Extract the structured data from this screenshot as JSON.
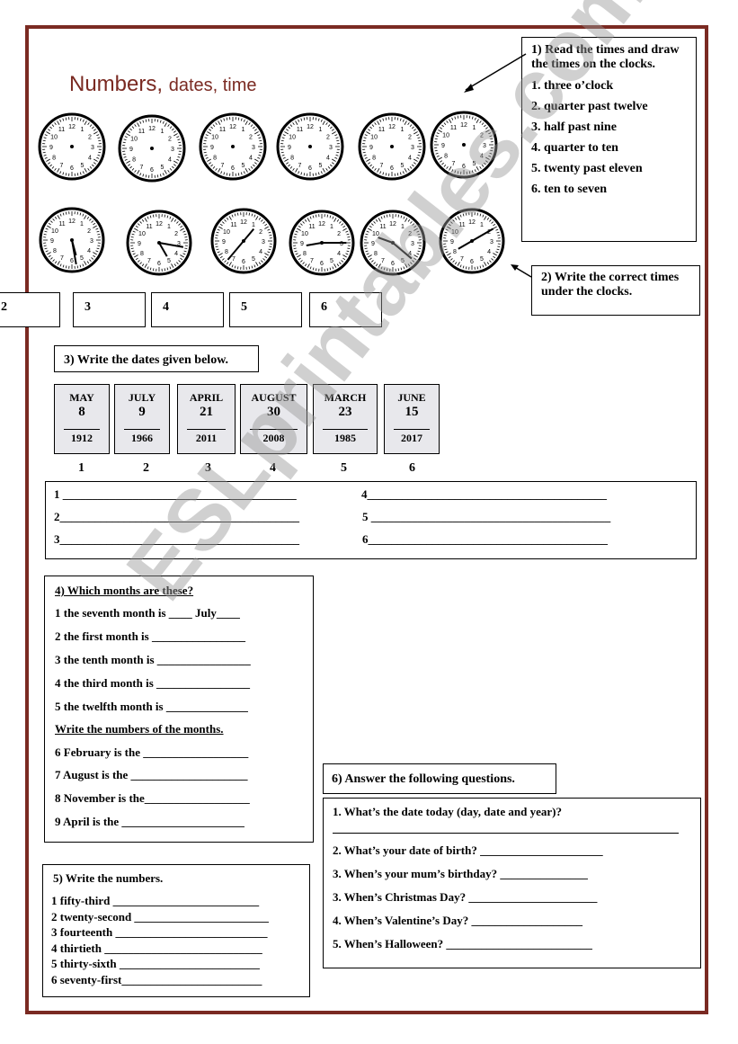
{
  "title": {
    "main": "Numbers,",
    "rest": "dates, time"
  },
  "section1": {
    "heading": "1) Read the times and draw the times on the clocks.",
    "items": [
      "1. three o’clock",
      "2. quarter past twelve",
      "3. half past nine",
      "4. quarter to ten",
      "5. twenty past eleven",
      "6. ten to seven"
    ]
  },
  "section2": {
    "heading": "2) Write the correct times under the clocks.",
    "boxes": [
      "2",
      "3",
      "4",
      "5",
      "6"
    ]
  },
  "section3": {
    "heading": "3) Write the dates given below.",
    "dates": [
      {
        "month": "MAY",
        "day": "8",
        "year": "1912",
        "n": "1"
      },
      {
        "month": "JULY",
        "day": "9",
        "year": "1966",
        "n": "2"
      },
      {
        "month": "APRIL",
        "day": "21",
        "year": "2011",
        "n": "3"
      },
      {
        "month": "AUGUST",
        "day": "30",
        "year": "2008",
        "n": "4"
      },
      {
        "month": "MARCH",
        "day": "23",
        "year": "1985",
        "n": "5"
      },
      {
        "month": "JUNE",
        "day": "15",
        "year": "2017",
        "n": "6"
      }
    ],
    "lines": [
      "1 ________________________________________",
      "2_________________________________________",
      "3_________________________________________",
      "4_________________________________________",
      "5 _________________________________________",
      "6_________________________________________"
    ]
  },
  "section4": {
    "heading": "4) Which months are these?",
    "items": [
      "1 the seventh month is ____ July____",
      "2 the first month is ________________",
      "3 the tenth month is ________________",
      "4 the third month is ________________",
      "5 the twelfth month is ______________"
    ],
    "subheading": "Write the numbers of the months.",
    "items2": [
      "6 February is the __________________",
      "7 August is the ____________________",
      "8 November is the__________________",
      "9 April is the _____________________"
    ]
  },
  "section5": {
    "heading": "5) Write the numbers.",
    "items": [
      "1 fifty-third _________________________",
      "2 twenty-second _______________________",
      "3 fourteenth __________________________",
      "4 thirtieth ___________________________",
      "5 thirty-sixth ________________________",
      "6 seventy-first________________________"
    ]
  },
  "section6": {
    "heading": "6)  Answer the following questions.",
    "items": [
      "1. What’s the date today (day, date and year)?",
      "2. What’s your date of birth? _____________________",
      "3. When’s your mum’s birthday? _______________",
      "3. When’s Christmas Day? ______________________",
      "4. When’s Valentine’s Day? ___________________",
      "5. When’s Halloween? _________________________"
    ]
  },
  "watermark": "ESLprintables.com"
}
